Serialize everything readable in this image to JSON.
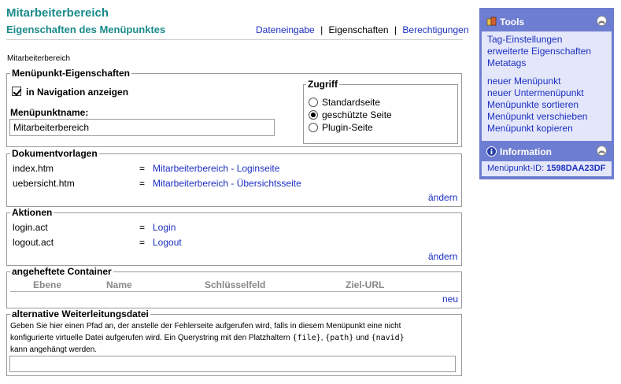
{
  "header": {
    "title": "Mitarbeiterbereich",
    "subtitle": "Eigenschaften des Menüpunktes",
    "nav": {
      "dateneingabe": "Dateneingabe",
      "sep1": "|",
      "eigenschaften": "Eigenschaften",
      "sep2": "|",
      "berechtigungen": "Berechtigungen"
    }
  },
  "breadcrumb": "Mitarbeiterbereich",
  "props": {
    "legend": "Menüpunkt-Eigenschaften",
    "show_in_nav_label": "in Navigation anzeigen",
    "name_label": "Menüpunktname:",
    "name_value": "Mitarbeiterbereich",
    "zugriff": {
      "legend": "Zugriff",
      "options": [
        "Standardseite",
        "geschützte Seite",
        "Plugin-Seite"
      ],
      "selected": "geschützte Seite"
    }
  },
  "docs": {
    "legend": "Dokumentvorlagen",
    "rows": [
      {
        "file": "index.htm",
        "eq": "=",
        "target": "Mitarbeiterbereich - Loginseite"
      },
      {
        "file": "uebersicht.htm",
        "eq": "=",
        "target": "Mitarbeiterbereich - Übersichtsseite"
      }
    ],
    "edit": "ändern"
  },
  "actions": {
    "legend": "Aktionen",
    "rows": [
      {
        "file": "login.act",
        "eq": "=",
        "target": "Login"
      },
      {
        "file": "logout.act",
        "eq": "=",
        "target": "Logout"
      }
    ],
    "edit": "ändern"
  },
  "containers": {
    "legend": "angeheftete Container",
    "columns": [
      "Ebene",
      "Name",
      "Schlüsselfeld",
      "Ziel-URL"
    ],
    "new": "neu"
  },
  "redirect": {
    "legend": "alternative Weiterleitungsdatei",
    "line1": "Geben Sie hier einen Pfad an, der anstelle der Fehlerseite aufgerufen wird, falls in diesem Menüpunkt eine nicht",
    "line2_a": "konfigurierte virtuelle Datei aufgerufen wird. Ein Querystring mit den Platzhaltern ",
    "ph_file": "{file}",
    "comma": ", ",
    "ph_path": "{path}",
    "und": " und ",
    "ph_navid": "{navid}",
    "line3": "kann angehängt werden.",
    "value": ""
  },
  "sidebar": {
    "tools": {
      "title": "Tools",
      "links_a": [
        "Tag-Einstellungen",
        "erweiterte Eigenschaften",
        "Metatags"
      ],
      "links_b": [
        "neuer Menüpunkt",
        "neuer Untermenüpunkt",
        "Menüpunkte sortieren",
        "Menüpunkt verschieben",
        "Menüpunkt kopieren"
      ]
    },
    "info": {
      "title": "Information",
      "id_label": "Menüpunkt-ID:",
      "id_value": "1598DAA23DF"
    }
  },
  "colors": {
    "accent": "#1a8a8a",
    "link": "#1c2fc0",
    "sidebar_bg": "#6d7dd1",
    "panel_bg": "#e4e7fa"
  }
}
